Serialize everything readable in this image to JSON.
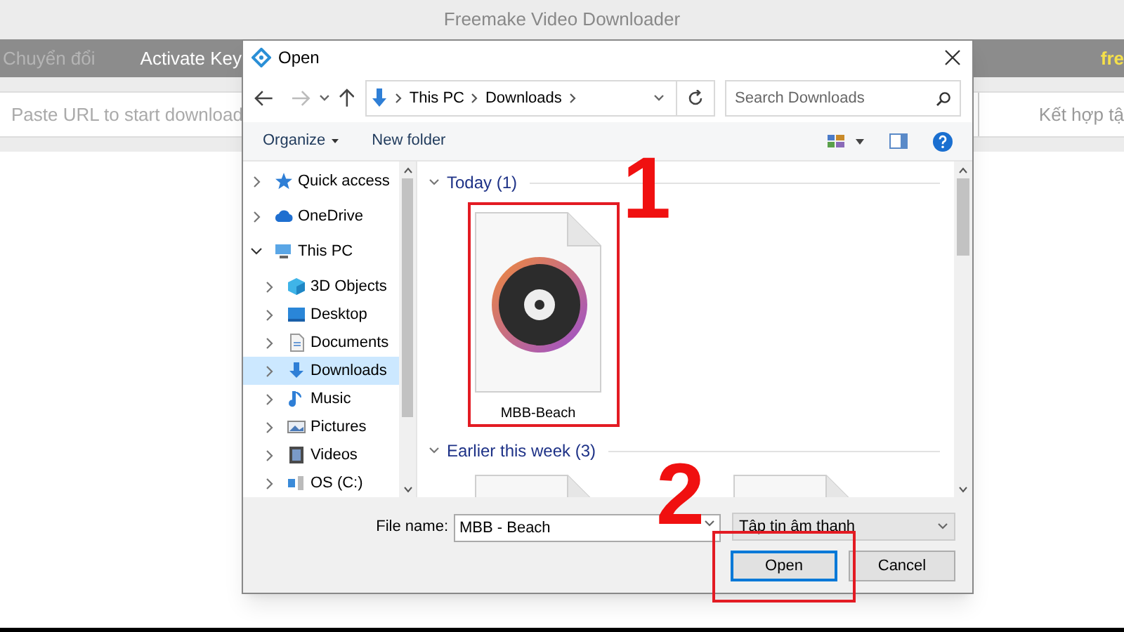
{
  "app": {
    "title": "Freemake Video Downloader",
    "menu": [
      {
        "label": "Chuyển đổi",
        "disabled": true
      },
      {
        "label": "Activate Key",
        "disabled": false
      }
    ],
    "brand": "fre",
    "url_field": {
      "placeholder": "Paste URL to start download"
    },
    "merge_label": "Kết hợp tậ"
  },
  "dialog": {
    "title": "Open",
    "path": [
      "This PC",
      "Downloads"
    ],
    "search": {
      "placeholder": "Search Downloads"
    },
    "commands": [
      "Organize",
      "New folder"
    ],
    "tree": [
      {
        "label": "Quick access",
        "kind": "star",
        "expanded": false,
        "selected": false
      },
      {
        "label": "OneDrive",
        "kind": "cloud",
        "expanded": false,
        "selected": false
      },
      {
        "label": "This PC",
        "kind": "pc",
        "expanded": true,
        "selected": false,
        "children": [
          {
            "label": "3D Objects",
            "kind": "cube",
            "expanded": false,
            "selected": false
          },
          {
            "label": "Desktop",
            "kind": "desktop",
            "expanded": false,
            "selected": false
          },
          {
            "label": "Documents",
            "kind": "document",
            "expanded": false,
            "selected": false
          },
          {
            "label": "Downloads",
            "kind": "download",
            "expanded": false,
            "selected": true
          },
          {
            "label": "Music",
            "kind": "music",
            "expanded": false,
            "selected": false
          },
          {
            "label": "Pictures",
            "kind": "picture",
            "expanded": false,
            "selected": false
          },
          {
            "label": "Videos",
            "kind": "video",
            "expanded": false,
            "selected": false
          },
          {
            "label": "OS (C:)",
            "kind": "drive",
            "expanded": false,
            "selected": false
          }
        ]
      }
    ],
    "groups": [
      {
        "label": "Today (1)",
        "files": [
          {
            "name": "MBB-Beach",
            "kind": "audio"
          }
        ]
      },
      {
        "label": "Earlier this week (3)",
        "files": [
          {
            "kind": "blank"
          },
          {
            "kind": "blank"
          }
        ]
      }
    ],
    "file_name_label": "File name:",
    "file_name": "MBB - Beach",
    "file_type": "Tập tin âm thanh",
    "buttons": [
      {
        "label": "Open",
        "default": true
      },
      {
        "label": "Cancel",
        "default": false
      }
    ]
  },
  "annotations": [
    {
      "label": "1"
    },
    {
      "label": "2"
    }
  ]
}
